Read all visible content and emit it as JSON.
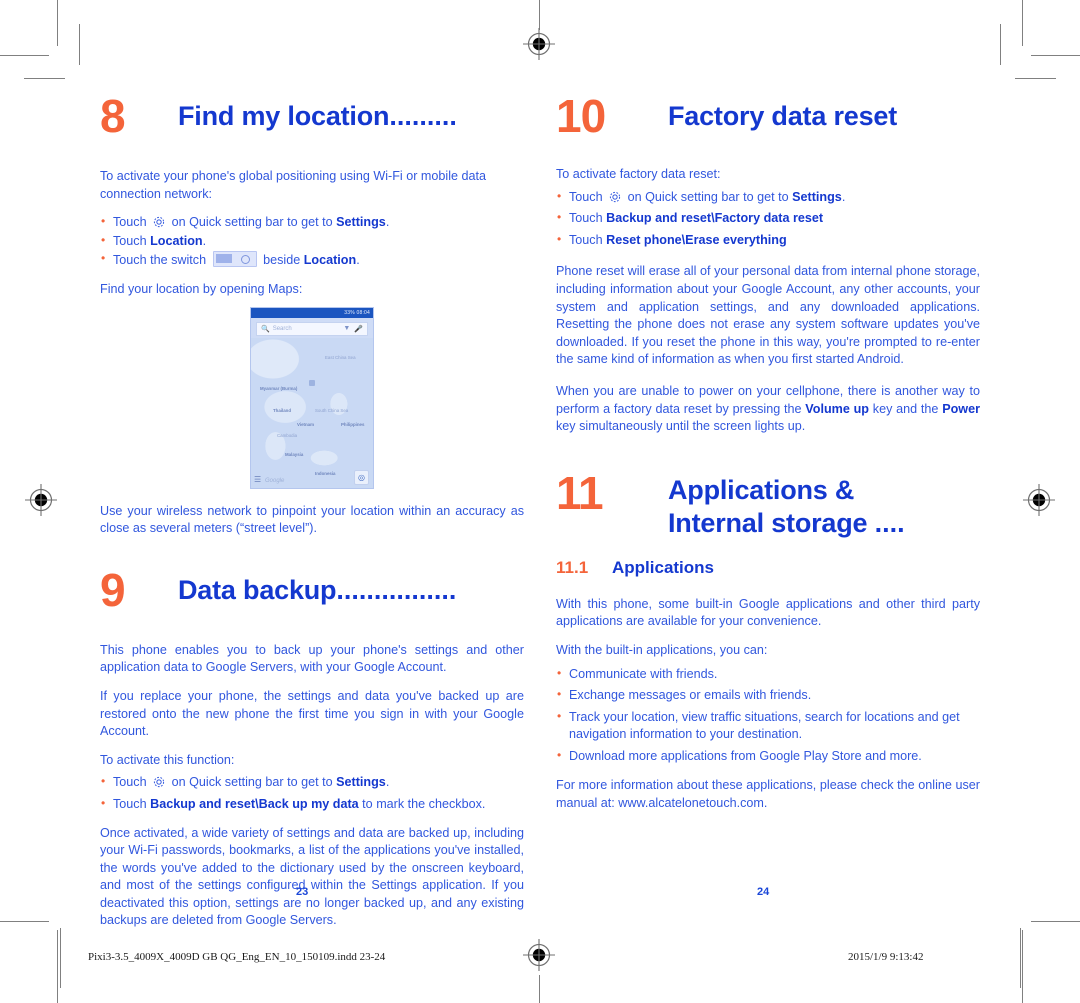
{
  "document": {
    "page_numbers": {
      "left": "23",
      "right": "24"
    },
    "footer": {
      "file": "Pixi3-3.5_4009X_4009D GB QG_Eng_EN_10_150109.indd   23-24",
      "timestamp": "2015/1/9   9:13:42"
    },
    "colors": {
      "accent_orange": "#F4643A",
      "heading_blue": "#1438CF",
      "body_blue": "#3157DE",
      "status_bar_blue": "#1B55C0"
    }
  },
  "left_column": {
    "chapter8": {
      "number": "8",
      "title": "Find my location",
      "dots": ".........",
      "intro": "To activate your phone's global positioning using Wi-Fi or mobile data connection network:",
      "bullets": [
        {
          "pre": "Touch ",
          "icon": "gear-icon",
          "mid": " on Quick setting bar to get to ",
          "bold": "Settings",
          "post": "."
        },
        {
          "pre": "Touch ",
          "bold": "Location",
          "post": "."
        },
        {
          "pre": "Touch the switch ",
          "icon": "toggle-switch-icon",
          "mid": " beside ",
          "bold": "Location",
          "post": "."
        }
      ],
      "after_bullets": "Find your location by opening Maps:",
      "closing": "Use your wireless network to pinpoint your location within an accuracy as close as several meters (“street level”)."
    },
    "phone_screenshot": {
      "status_bar": "33%  08:04",
      "search_placeholder": "Search",
      "search_icons": [
        "search-icon",
        "filter-icon",
        "microphone-icon"
      ],
      "map_labels": [
        "Myanmar (Burma)",
        "Thailand",
        "Vietnam",
        "South China Sea",
        "Philippines",
        "Cambodia",
        "Malaysia",
        "Indonesia",
        "East China Sea"
      ],
      "google_watermark": "Google",
      "menu_icon": "hamburger-menu-icon",
      "location_icon": "my-location-icon"
    },
    "chapter9": {
      "number": "9",
      "title": "Data backup",
      "dots": "................",
      "paragraphs": [
        "This phone enables you to back up your phone's settings and other application data to Google Servers, with your Google Account.",
        "If you replace your phone, the settings and data you've backed up are restored onto the new phone the first time you sign in with your Google Account.",
        "To activate this function:"
      ],
      "bullets": [
        {
          "pre": "Touch ",
          "icon": "gear-icon",
          "mid": " on Quick setting bar to get to ",
          "bold": "Settings",
          "post": "."
        },
        {
          "pre": "Touch ",
          "bold": "Backup and reset\\Back up my data",
          "post": " to mark the checkbox."
        }
      ],
      "closing": "Once activated, a wide variety of settings and data are backed up, including your Wi-Fi passwords, bookmarks, a list of the applications you've installed, the words you've added to the dictionary used by the onscreen keyboard, and most of the settings configured within the Settings application. If you deactivated this option, settings are no longer backed up, and any existing backups are deleted from Google Servers."
    }
  },
  "right_column": {
    "chapter10": {
      "number": "10",
      "title": "Factory data reset",
      "intro": "To activate factory data reset:",
      "bullets": [
        {
          "pre": "Touch ",
          "icon": "gear-icon",
          "mid": " on Quick setting bar to get to ",
          "bold": "Settings",
          "post": "."
        },
        {
          "pre": "Touch ",
          "bold": "Backup and reset\\Factory data reset",
          "post": ""
        },
        {
          "pre": "Touch ",
          "bold": "Reset phone\\Erase everything",
          "post": ""
        }
      ],
      "paragraphs": [
        "Phone reset will erase all of your personal data from internal phone storage, including information about your Google Account, any other accounts, your system and application settings, and any downloaded applications. Resetting the phone does not erase any system software updates you've downloaded. If you reset the phone in this way, you're prompted to re-enter the same kind of information as when you first started Android."
      ],
      "final_paragraph": {
        "part1": "When you are unable to power on your cellphone, there is another way to perform a factory data reset by pressing the ",
        "bold1": "Volume up",
        "part2": " key and the ",
        "bold2": "Power",
        "part3": " key simultaneously until the screen lights up."
      }
    },
    "chapter11": {
      "number": "11",
      "title_line1": "Applications &",
      "title_line2": "Internal storage",
      "dots": "....",
      "section": {
        "number": "11.1",
        "title": "Applications"
      },
      "paragraphs": [
        "With this phone, some built-in Google applications and other third party applications are available for your convenience.",
        "With the built-in applications, you can:"
      ],
      "bullets": [
        "Communicate with friends.",
        "Exchange messages or emails with friends.",
        "Track your location, view traffic situations, search for locations and get navigation information to your destination.",
        "Download more applications from Google Play Store and more."
      ],
      "closing": "For more information about these applications, please check the online user manual at: www.alcatelonetouch.com."
    }
  }
}
